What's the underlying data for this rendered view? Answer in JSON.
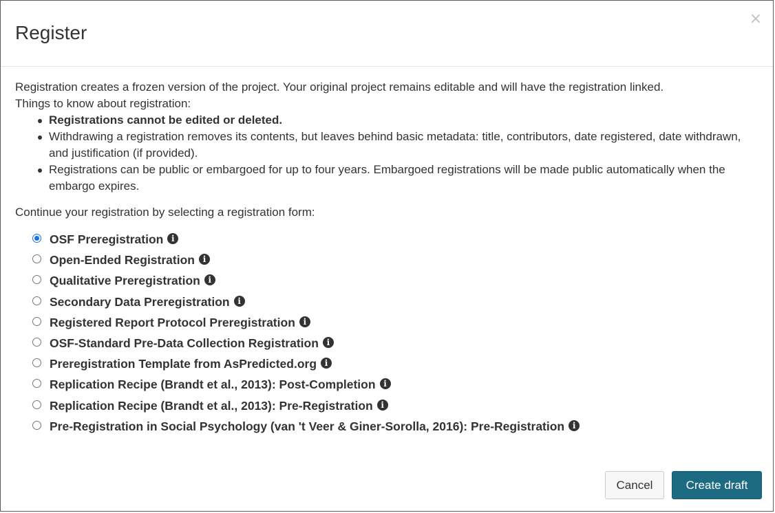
{
  "dialog": {
    "title": "Register",
    "close_label": "×"
  },
  "body": {
    "intro": "Registration creates a frozen version of the project. Your original project remains editable and will have the registration linked.",
    "things_heading": "Things to know about registration:",
    "rules": [
      "Registrations cannot be edited or deleted.",
      "Withdrawing a registration removes its contents, but leaves behind basic metadata: title, contributors, date registered, date withdrawn, and justification (if provided).",
      "Registrations can be public or embargoed for up to four years. Embargoed registrations will be made public automatically when the embargo expires."
    ],
    "select_prompt": "Continue your registration by selecting a registration form:"
  },
  "forms": [
    {
      "label": "OSF Preregistration",
      "selected": true
    },
    {
      "label": "Open-Ended Registration",
      "selected": false
    },
    {
      "label": "Qualitative Preregistration",
      "selected": false
    },
    {
      "label": "Secondary Data Preregistration",
      "selected": false
    },
    {
      "label": "Registered Report Protocol Preregistration",
      "selected": false
    },
    {
      "label": "OSF-Standard Pre-Data Collection Registration",
      "selected": false
    },
    {
      "label": "Preregistration Template from AsPredicted.org",
      "selected": false
    },
    {
      "label": "Replication Recipe (Brandt et al., 2013): Post-Completion",
      "selected": false
    },
    {
      "label": "Replication Recipe (Brandt et al., 2013): Pre-Registration",
      "selected": false
    },
    {
      "label": "Pre-Registration in Social Psychology (van 't Veer & Giner-Sorolla, 2016): Pre-Registration",
      "selected": false
    }
  ],
  "info_icon": "info-circle-icon",
  "footer": {
    "cancel_label": "Cancel",
    "create_label": "Create draft"
  },
  "colors": {
    "primary_button": "#1d6b82",
    "radio_selected": "#1a73e8"
  }
}
